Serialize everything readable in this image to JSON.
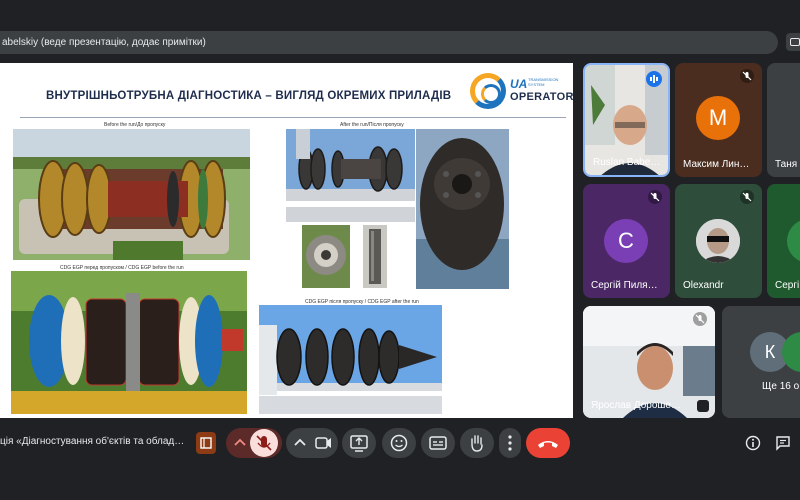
{
  "presenter_banner": {
    "text": "abelskiy (веде презентацію, додає примітки)"
  },
  "slide": {
    "title": "ВНУТРІШНЬОТРУБНА ДІАГНОСТИКА – ВИГЛЯД ОКРЕМИХ ПРИЛАДІВ",
    "logo": {
      "ua": "UA",
      "small": "TRANSMISSION\nSYSTEM",
      "operator": "OPERATOR"
    },
    "captions": {
      "top_left": "Before the run/До пропуску",
      "top_right": "After the run/Після пропуску",
      "bottom_left": "CDG EGP перед пропуском  / CDG EGP before the run",
      "bottom_right": "CDG EGP після пропуску / CDG EGP after the run"
    }
  },
  "participants": [
    {
      "name": "Ruslan Babe…",
      "initial": "",
      "speaking": true
    },
    {
      "name": "Максим Лин…",
      "initial": "М",
      "color": "#e8710a"
    },
    {
      "name": "Таня Б",
      "initial": "",
      "color": "#3c4043"
    },
    {
      "name": "Сергій Пиля…",
      "initial": "С",
      "color": "#7b3fb5"
    },
    {
      "name": "Olexandr",
      "initial": "",
      "color": "#2e4d3a"
    },
    {
      "name": "Сергі",
      "initial": "",
      "color": "#1e5a2e"
    },
    {
      "name": "Ярослав Дороше…",
      "initial": "",
      "color": "#cfd8dc"
    }
  ],
  "more_tile": {
    "initial": "К",
    "text": "Ще 16 о"
  },
  "meeting": {
    "title": "ція «Діагностування об'єктів та облад…"
  },
  "colors": {
    "accent_red": "#ea4335",
    "dark_red": "#8c1d18",
    "mic_muted_bg": "#5c2b29"
  }
}
